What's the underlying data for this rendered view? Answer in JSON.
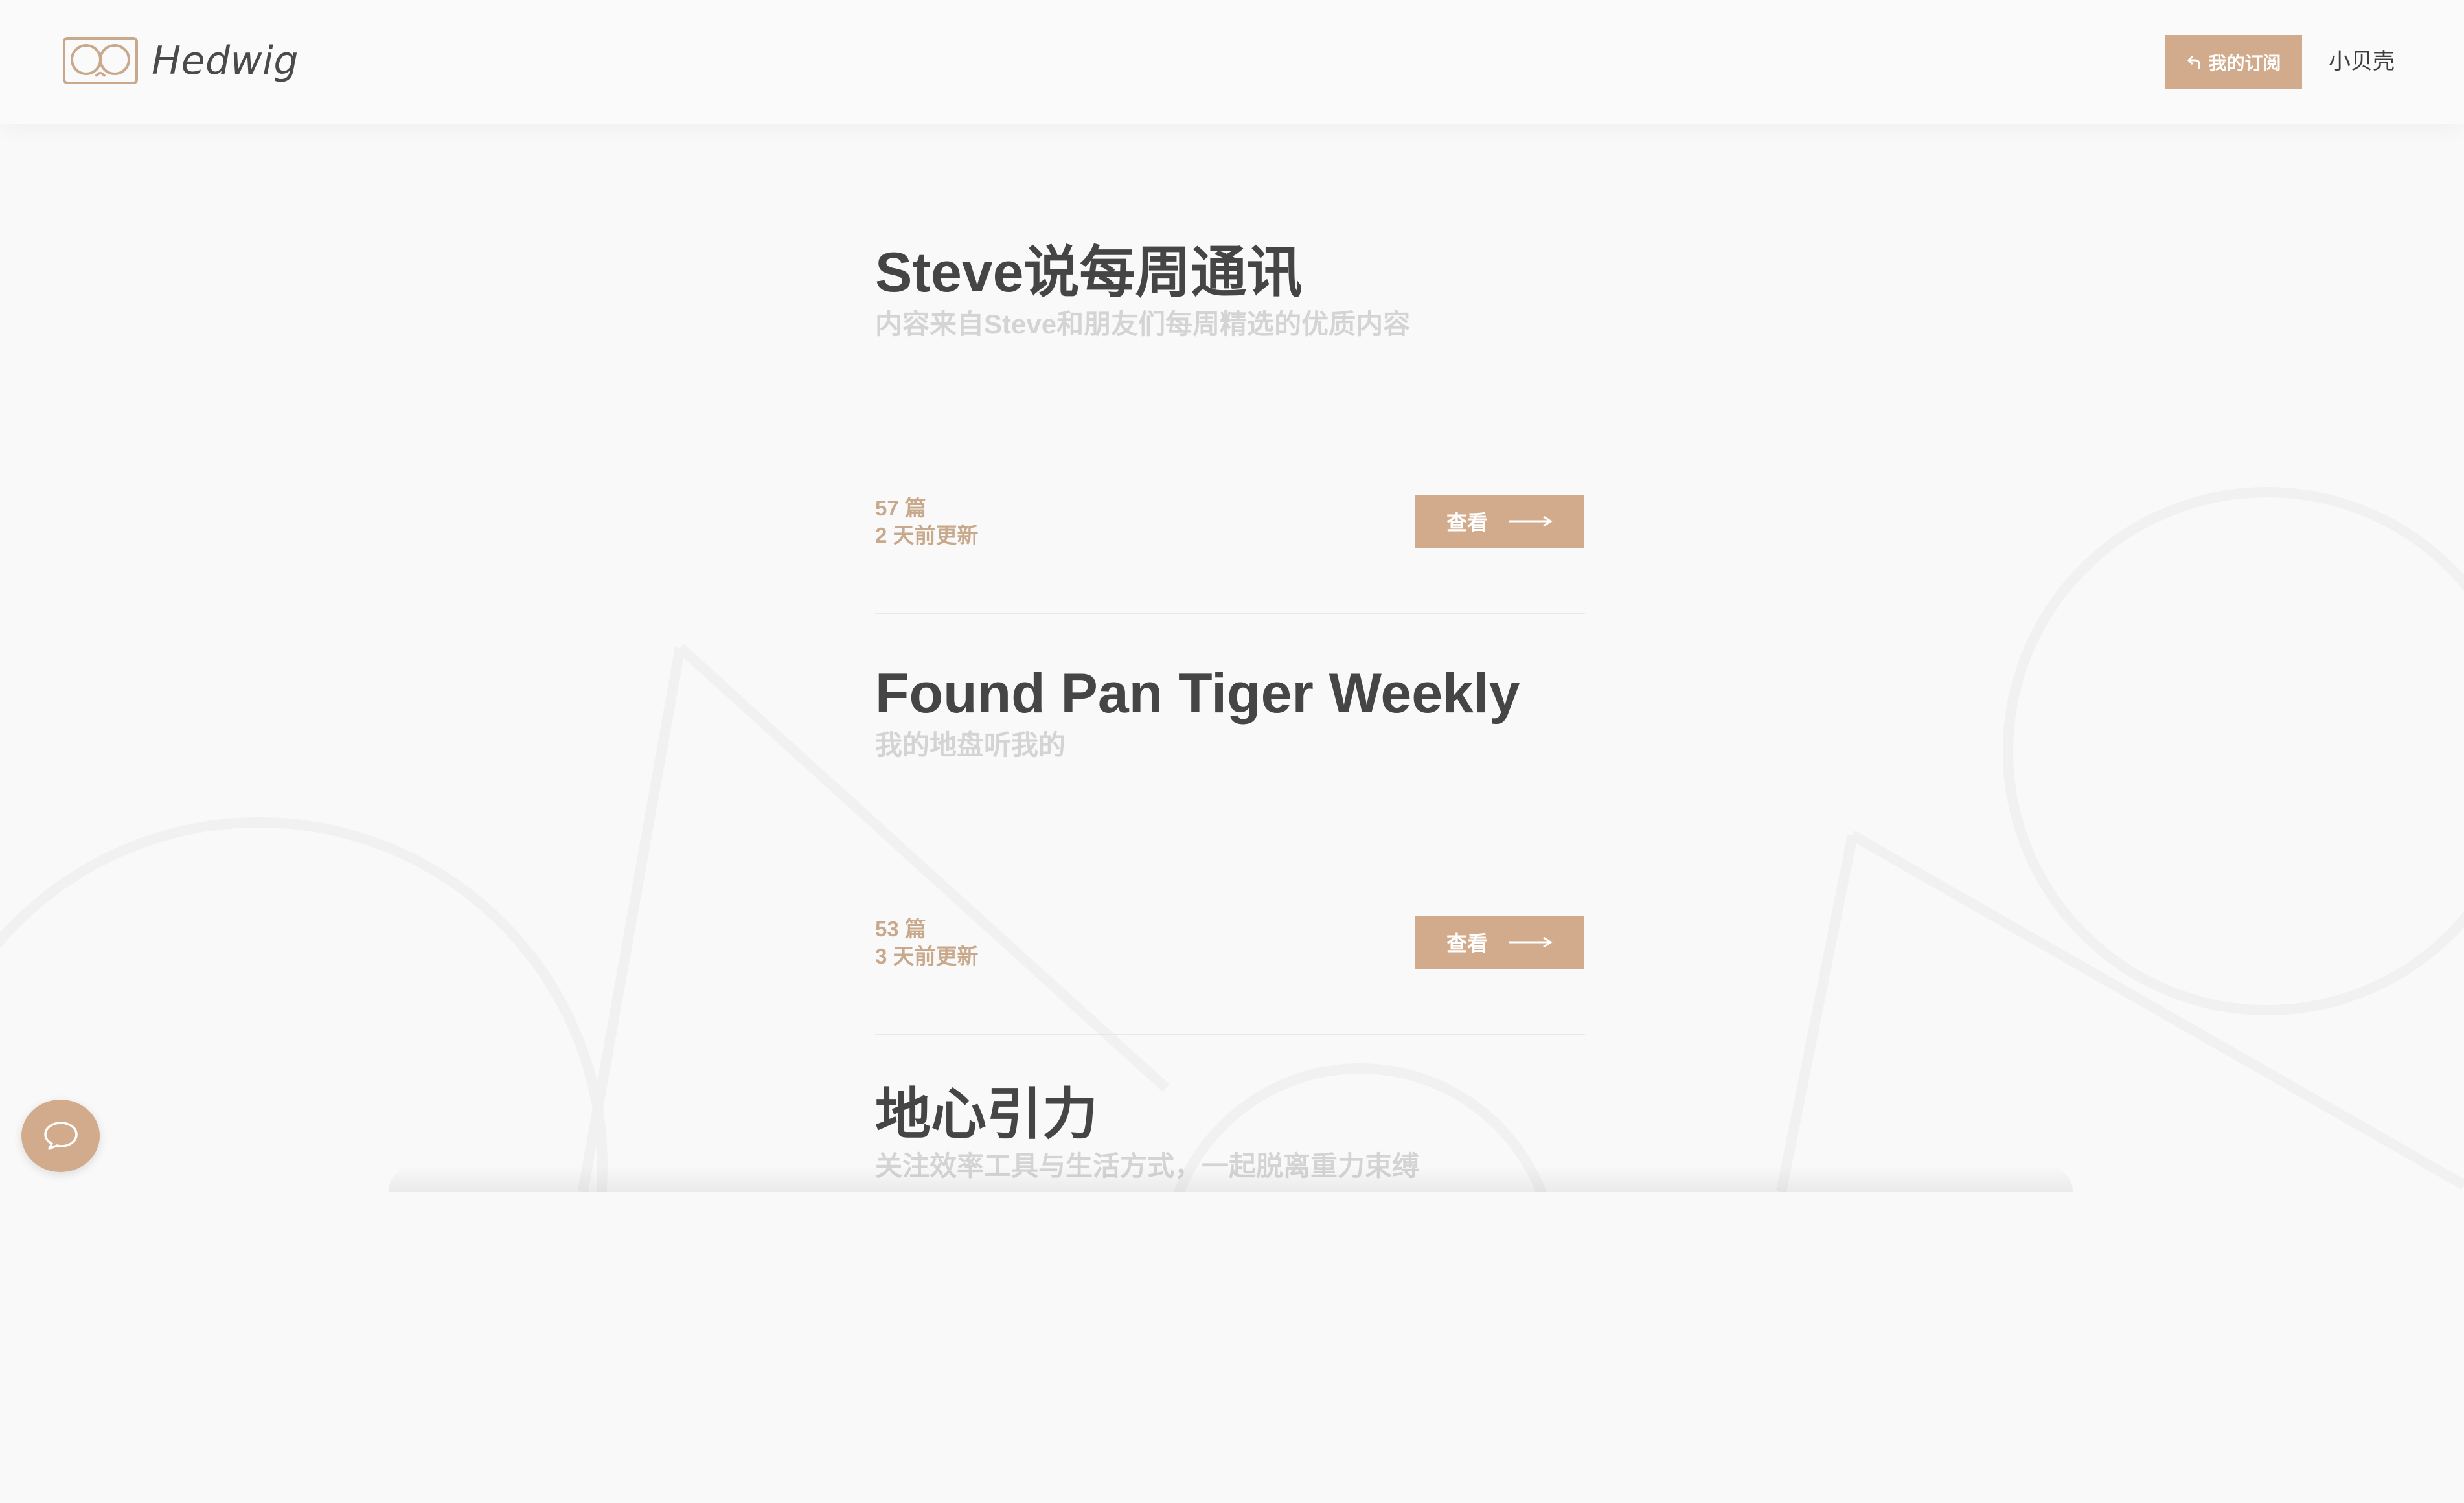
{
  "brand": {
    "name": "Hedwig"
  },
  "header": {
    "subscriptions_label": "我的订阅",
    "user_name": "小贝壳"
  },
  "feeds": [
    {
      "title": "Steve说每周通讯",
      "description": "内容来自Steve和朋友们每周精选的优质内容",
      "count": "57 篇",
      "updated": "2 天前更新",
      "view_label": "查看"
    },
    {
      "title": "Found Pan Tiger Weekly",
      "description": "我的地盘听我的",
      "count": "53 篇",
      "updated": "3 天前更新",
      "view_label": "查看"
    },
    {
      "title": "地心引力",
      "description": "关注效率工具与生活方式，一起脱离重力束缚"
    }
  ],
  "colors": {
    "accent": "#d1ab8b",
    "title_text": "#454545",
    "muted_text": "#d4d4d4",
    "meta_text": "#c9a98c",
    "background": "#f9f9f9"
  },
  "icons": {
    "logo": "hedwig-glasses-logo",
    "back": "back-arrow-icon",
    "view": "long-right-arrow-icon",
    "chat": "chat-bubble-icon"
  }
}
